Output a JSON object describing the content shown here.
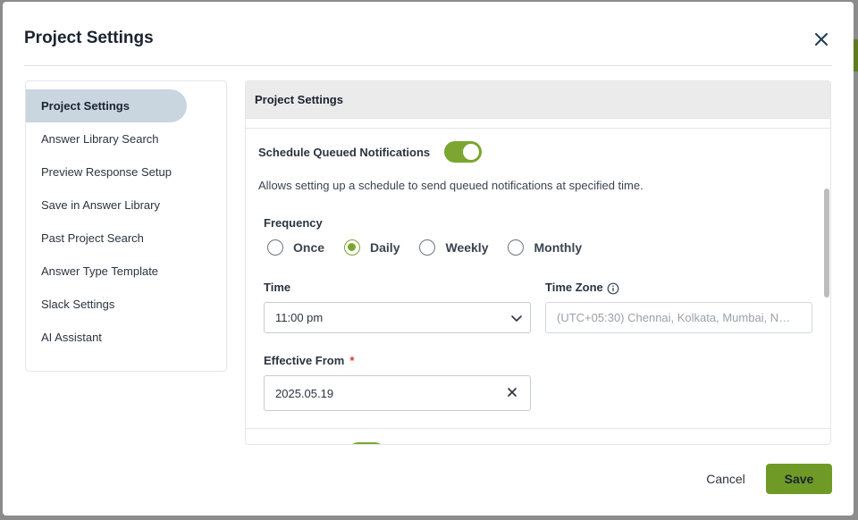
{
  "modal": {
    "title": "Project Settings",
    "close_icon": "close-icon"
  },
  "sidebar": {
    "items": [
      {
        "label": "Project Settings",
        "active": true
      },
      {
        "label": "Answer Library Search"
      },
      {
        "label": "Preview Response Setup"
      },
      {
        "label": "Save in Answer Library"
      },
      {
        "label": "Past Project Search"
      },
      {
        "label": "Answer Type Template"
      },
      {
        "label": "Slack Settings"
      },
      {
        "label": "AI Assistant"
      }
    ]
  },
  "panel": {
    "header": "Project Settings",
    "schedule": {
      "label": "Schedule Queued Notifications",
      "enabled": true,
      "description": "Allows setting up a schedule to send queued notifications at specified time."
    },
    "frequency": {
      "label": "Frequency",
      "options": [
        "Once",
        "Daily",
        "Weekly",
        "Monthly"
      ],
      "selected": "Daily"
    },
    "time": {
      "label": "Time",
      "value": "11:00 pm"
    },
    "time_zone": {
      "label": "Time Zone",
      "placeholder": "(UTC+05:30) Chennai, Kolkata, Mumbai, N…"
    },
    "effective_from": {
      "label": "Effective From",
      "required_mark": "*",
      "value": "2025.05.19"
    }
  },
  "footer": {
    "cancel_label": "Cancel",
    "save_label": "Save"
  },
  "colors": {
    "accent": "#7aa631",
    "save_button": "#6e9a25",
    "active_nav": "#c9d5df"
  }
}
